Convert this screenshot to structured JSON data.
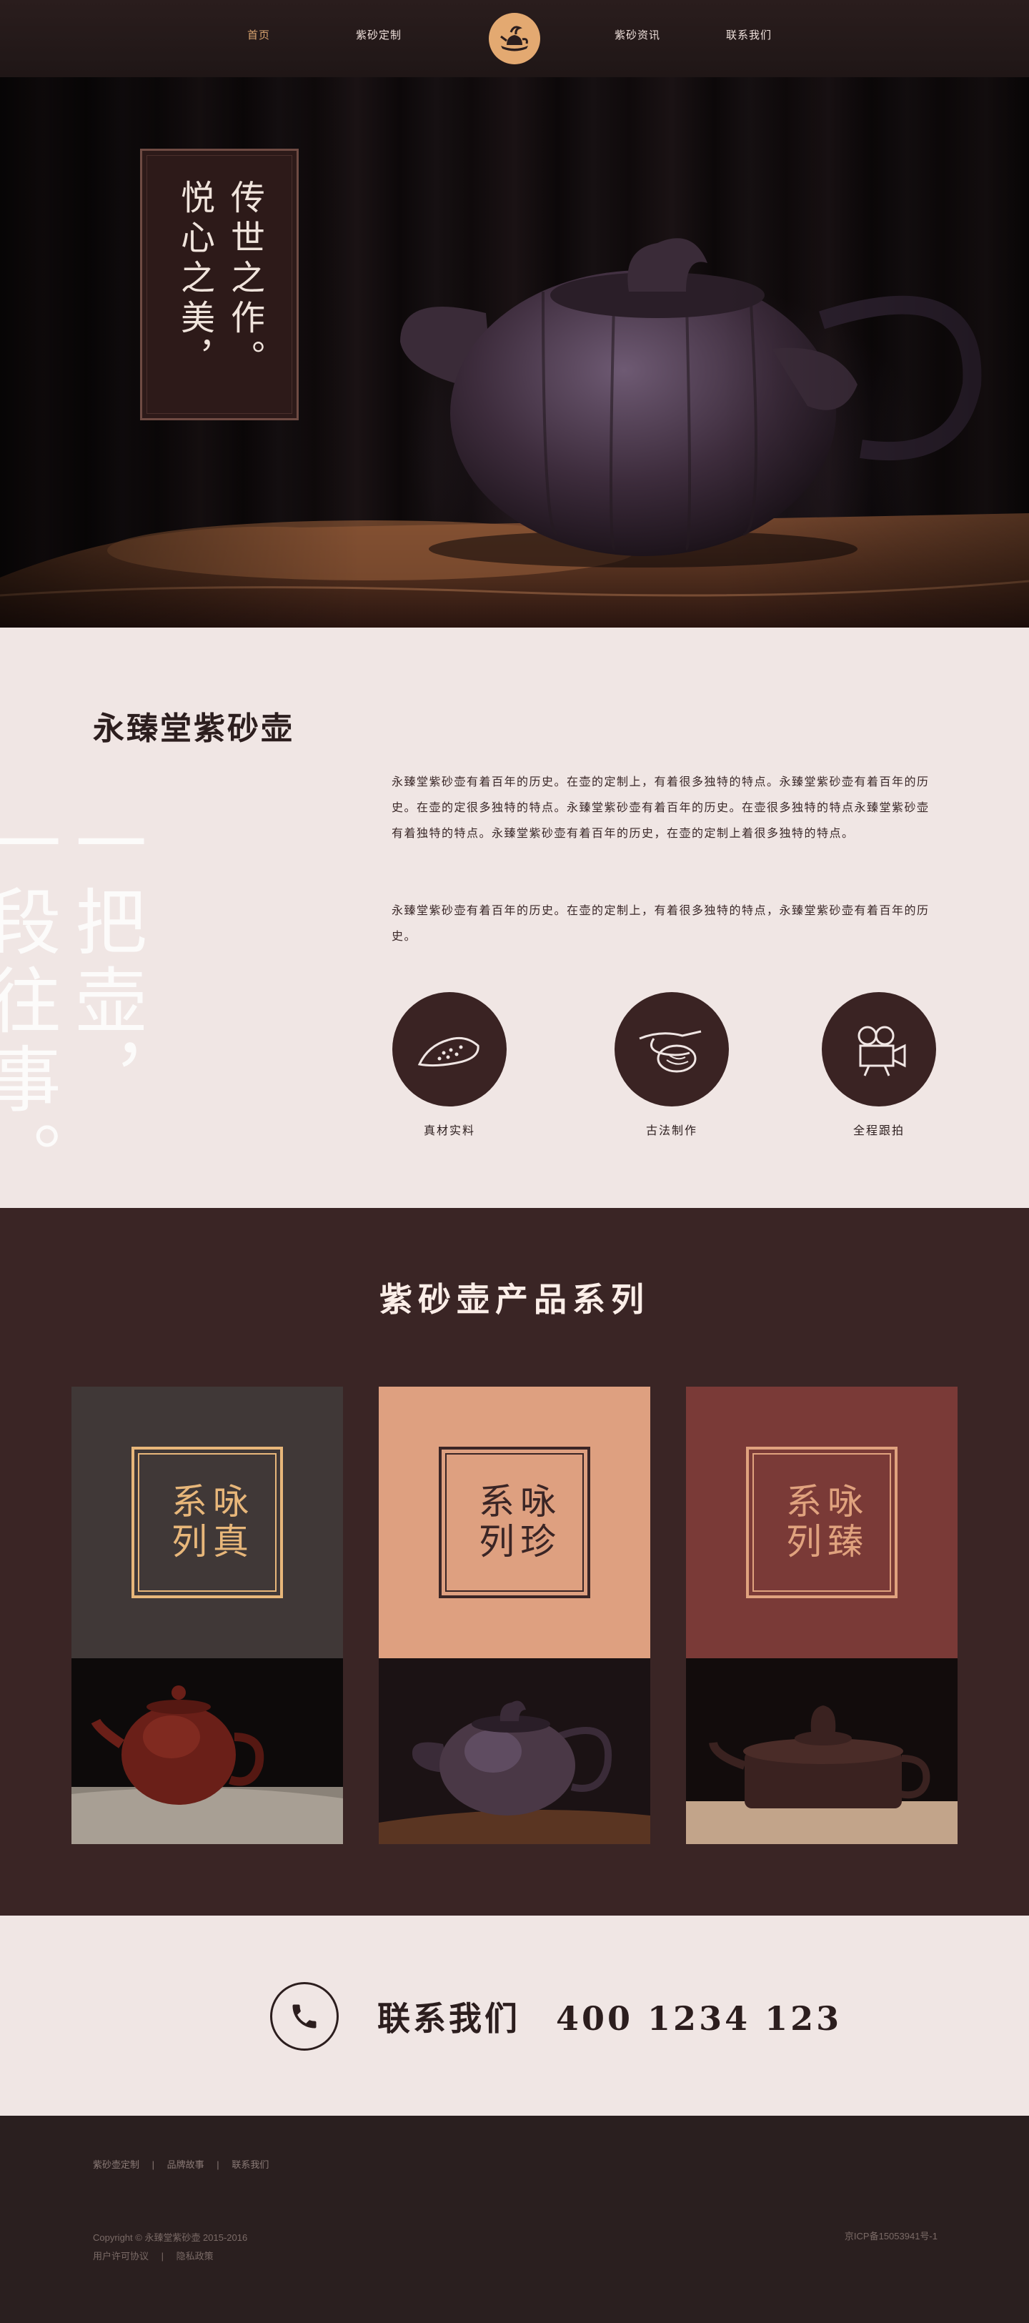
{
  "nav": {
    "items": [
      {
        "label": "首页",
        "active": true
      },
      {
        "label": "紫砂定制",
        "active": false
      },
      {
        "label": "紫砂资讯",
        "active": false
      },
      {
        "label": "联系我们",
        "active": false
      }
    ],
    "logo_icon": "teapot-brush-logo"
  },
  "hero": {
    "poem_col1": "悦心之美，",
    "poem_col2": "传世之作。"
  },
  "intro": {
    "title": "永臻堂紫砂壶",
    "bg_col1": "一把壶，",
    "bg_col2": "一段往事。",
    "para1": "永臻堂紫砂壶有着百年的历史。在壶的定制上，有着很多独特的特点。永臻堂紫砂壶有着百年的历史。在壶的定很多独特的特点。永臻堂紫砂壶有着百年的历史。在壶很多独特的特点永臻堂紫砂壶有着独特的特点。永臻堂紫砂壶有着百年的历史，在壶的定制上着很多独特的特点。",
    "para2": "永臻堂紫砂壶有着百年的历史。在壶的定制上，有着很多独特的特点，永臻堂紫砂壶有着百年的历史。",
    "features": [
      {
        "label": "真材实料",
        "icon": "clay-pile-icon"
      },
      {
        "label": "古法制作",
        "icon": "hands-shaping-icon"
      },
      {
        "label": "全程跟拍",
        "icon": "video-camera-icon"
      }
    ]
  },
  "products": {
    "title": "紫砂壶产品系列",
    "cards": [
      {
        "col1": "咏真",
        "col2": "系列",
        "bg": "#403837",
        "frame": "#e8b77a"
      },
      {
        "col1": "咏珍",
        "col2": "系列",
        "bg": "#dea080",
        "frame": "#3a2525"
      },
      {
        "col1": "咏臻",
        "col2": "系列",
        "bg": "#7a3a37",
        "frame": "#e0a27e"
      }
    ]
  },
  "contact": {
    "label": "联系我们",
    "phone": "400 1234 123",
    "icon": "phone-icon"
  },
  "footer": {
    "links": [
      "紫砂壶定制",
      "品牌故事",
      "联系我们"
    ],
    "copyright": "Copyright © 永臻堂紫砂壶 2015-2016",
    "policy_links": [
      "用户许可协议",
      "隐私政策"
    ],
    "icp": "京ICP备15053941号-1"
  }
}
